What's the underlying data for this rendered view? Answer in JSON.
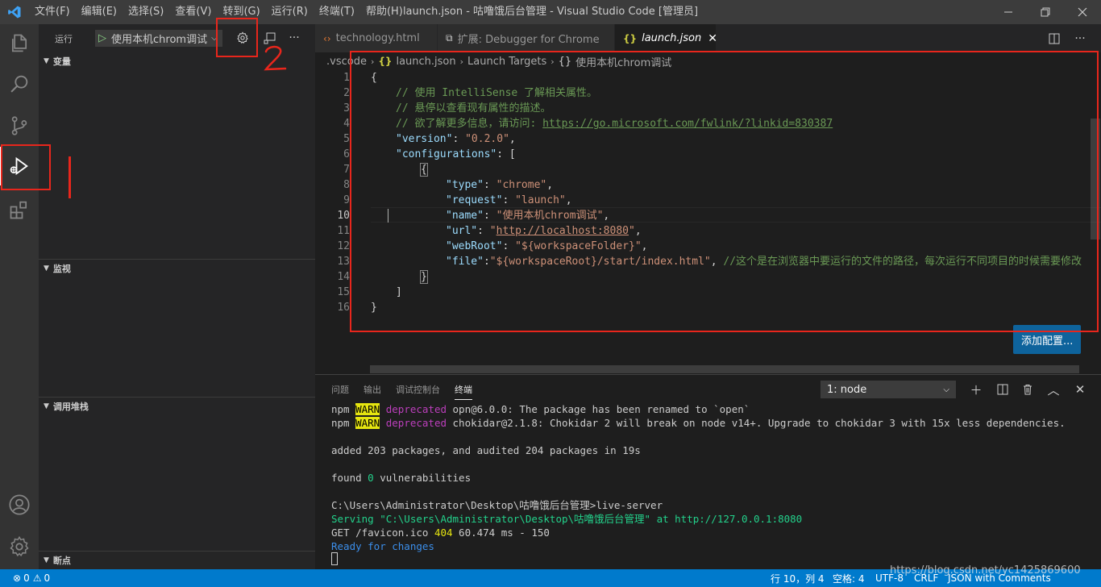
{
  "titlebar": {
    "logo": "vscode-logo",
    "menu": [
      "文件(F)",
      "编辑(E)",
      "选择(S)",
      "查看(V)",
      "转到(G)",
      "运行(R)",
      "终端(T)",
      "帮助(H)"
    ],
    "window_title": "launch.json - 咕噜饿后台管理 - Visual Studio Code [管理员]"
  },
  "activitybar": {
    "items": [
      "explorer-icon",
      "search-icon",
      "source-control-icon",
      "run-debug-icon",
      "extensions-icon"
    ],
    "bottom": [
      "account-icon",
      "settings-gear-icon"
    ]
  },
  "sidebar": {
    "title": "运行",
    "run_config": "使用本机chrom调试",
    "sections": {
      "variables": "变量",
      "watch": "监视",
      "call_stack": "调用堆栈",
      "breakpoints": "断点"
    }
  },
  "tabs": [
    {
      "label": "technology.html",
      "icon": "<>",
      "active": false
    },
    {
      "label": "扩展: Debugger for Chrome",
      "icon": "ext",
      "active": false
    },
    {
      "label": "launch.json",
      "icon": "{}",
      "active": true
    }
  ],
  "breadcrumb": {
    "folder": ".vscode",
    "file": "launch.json",
    "node1": "Launch Targets",
    "node2": "使用本机chrom调试"
  },
  "editor": {
    "line_numbers": [
      "1",
      "2",
      "3",
      "4",
      "5",
      "6",
      "7",
      "8",
      "9",
      "10",
      "11",
      "12",
      "13",
      "14",
      "15",
      "16"
    ],
    "open_brace": "{",
    "comment1": "// 使用 IntelliSense 了解相关属性。",
    "comment2": "// 悬停以查看现有属性的描述。",
    "comment3_text": "// 欲了解更多信息，请访问: ",
    "comment3_url": "https://go.microsoft.com/fwlink/?linkid=830387",
    "version_key": "\"version\"",
    "version_val": "\"0.2.0\"",
    "configurations_key": "\"configurations\"",
    "type_key": "\"type\"",
    "type_val": "\"chrome\"",
    "request_key": "\"request\"",
    "request_val": "\"launch\"",
    "name_key": "\"name\"",
    "name_val": "\"使用本机chrom调试\"",
    "url_key": "\"url\"",
    "url_val": "http://localhost:8080",
    "webroot_key": "\"webRoot\"",
    "webroot_val": "\"${workspaceFolder}\"",
    "file_key": "\"file\"",
    "file_val": "\"${workspaceRoot}/start/index.html\"",
    "file_comment": "//这个是在浏览器中要运行的文件的路径，每次运行不同项目的时候需要修改",
    "add_config_button": "添加配置..."
  },
  "panel": {
    "tabs": [
      "问题",
      "输出",
      "调试控制台",
      "终端"
    ],
    "active_tab": "终端",
    "terminal_select": "1: node",
    "terminal": {
      "l1_npm": "npm ",
      "l1_warn": "WARN",
      "l1_dep": " deprecated ",
      "l1_rest": "opn@6.0.0: The package has been renamed to `open`",
      "l2_npm": "npm ",
      "l2_warn": "WARN",
      "l2_dep": " deprecated ",
      "l2_rest": "chokidar@2.1.8: Chokidar 2 will break on node v14+. Upgrade to chokidar 3 with 15x less dependencies.",
      "l3": "added 203 packages, and audited 204 packages in 19s",
      "l4_a": "found ",
      "l4_num": "0",
      "l4_b": " vulnerabilities",
      "l5": "C:\\Users\\Administrator\\Desktop\\咕噜饿后台管理>live-server",
      "l6_a": "Serving \"C:\\Users\\Administrator\\Desktop\\咕噜饿后台管理\" at ",
      "l6_url": "http://127.0.0.1:8080",
      "l7_a": "GET /favicon.ico ",
      "l7_code": "404",
      "l7_b": " 60.474 ms - 150",
      "l8": "Ready for changes"
    }
  },
  "statusbar": {
    "errors": "0",
    "warnings": "0",
    "position": "行 10，列 4",
    "spaces": "空格: 4",
    "encoding": "UTF-8",
    "eol": "CRLF",
    "language": "JSON with Comments"
  },
  "watermark": "https://blog.csdn.net/yc1425869600",
  "annotations": {
    "step2_label": "2",
    "colors": {
      "annotation": "#e8261c",
      "accent": "#007acc"
    }
  }
}
